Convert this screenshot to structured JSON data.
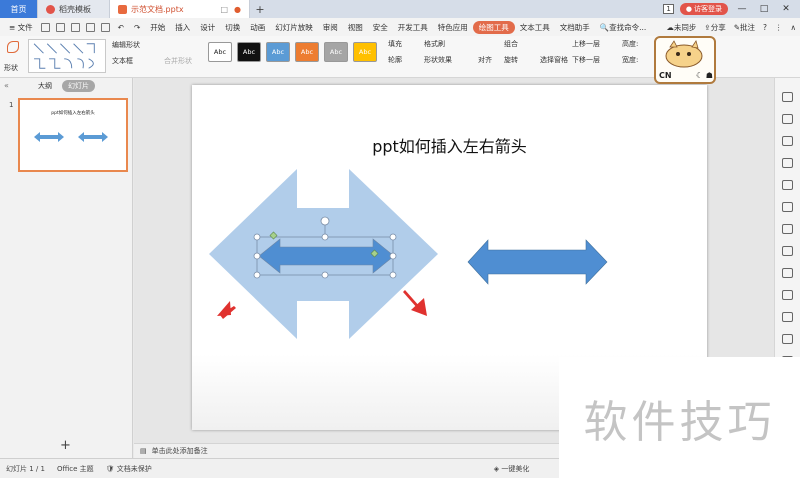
{
  "tabs": {
    "home": "首页",
    "store": "稻壳模板",
    "doc": "示范文档.pptx",
    "page_badge": "1",
    "login": "访客登录"
  },
  "menu": {
    "file": "文件",
    "items": [
      "开始",
      "插入",
      "设计",
      "切换",
      "动画",
      "幻灯片放映",
      "审阅",
      "视图",
      "安全",
      "开发工具",
      "特色应用",
      "绘图工具",
      "文本工具",
      "文档助手"
    ],
    "active_index": 11,
    "search": "查找命令...",
    "sync": "未同步",
    "share": "分享",
    "comment": "批注"
  },
  "ribbon": {
    "shape": "形状",
    "edit_shape": "编辑形状",
    "textbox": "文本框",
    "merge_shape": "合并形状",
    "style_label": "Abc",
    "styles": [
      {
        "bg": "#ffffff",
        "fg": "#222222"
      },
      {
        "bg": "#111111",
        "fg": "#ffffff"
      },
      {
        "bg": "#5b9bd5",
        "fg": "#ffffff"
      },
      {
        "bg": "#ed7d31",
        "fg": "#ffffff"
      },
      {
        "bg": "#a5a5a5",
        "fg": "#ffffff"
      },
      {
        "bg": "#ffc000",
        "fg": "#ffffff"
      }
    ],
    "fill": "填充",
    "outline": "轮廓",
    "format_brush": "格式刷",
    "shape_effect": "形状效果",
    "align": "对齐",
    "group": "组合",
    "rotate": "旋转",
    "select_pane": "选择窗格",
    "bring_forward": "上移一层",
    "send_backward": "下移一层",
    "height": "高度:",
    "width": "宽度:"
  },
  "left_panel": {
    "outline_tab": "大纲",
    "slides_tab": "幻灯片",
    "slide_number": "1",
    "thumb_title": "ppt如何插入左右箭头"
  },
  "slide": {
    "title": "ppt如何插入左右箭头",
    "accent": "#5b9bd5",
    "arrow_fill": "#5b9bd5",
    "ghost_fill": "#a8c8e8",
    "annotation_color": "#e0322f"
  },
  "mascot": {
    "text": "CN"
  },
  "notes": {
    "placeholder": "单击此处添加备注"
  },
  "status": {
    "slide_info": "幻灯片 1 / 1",
    "theme": "Office 主题",
    "protection": "文档未保护",
    "beautify": "一键美化"
  },
  "watermark": {
    "text": "软件技巧"
  }
}
